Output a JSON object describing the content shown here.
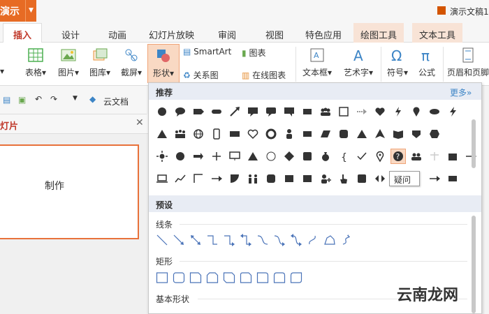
{
  "app": {
    "menu_label": "演示",
    "doc_title": "演示文稿1"
  },
  "tabs": [
    "插入",
    "设计",
    "动画",
    "幻灯片放映",
    "审阅",
    "视图",
    "特色应用",
    "绘图工具",
    "文本工具"
  ],
  "ribbon": {
    "table": "表格",
    "picture": "图片",
    "gallery": "图库",
    "screenshot": "截屏",
    "shapes": "形状",
    "smartart": "SmartArt",
    "chart": "图表",
    "relation": "关系图",
    "online_chart": "在线图表",
    "textbox": "文本框",
    "wordart": "艺术字",
    "symbol": "符号",
    "formula": "公式",
    "header_footer": "页眉和页脚"
  },
  "quickbar": {
    "cloud_docs": "云文档"
  },
  "left_panel": {
    "title": "灯片",
    "slide_text": "制作"
  },
  "dropdown": {
    "recommend_label": "推荐",
    "more_label": "更多»",
    "preset_label": "预设",
    "lines_label": "线条",
    "rect_label": "矩形",
    "basic_label": "基本形状",
    "tooltip": "疑问"
  },
  "watermark": "云南龙网",
  "colors": {
    "accent": "#e76b24",
    "selected_bg": "#f9d9c3",
    "shape_fill": "#333333",
    "line_blue": "#4a73b8",
    "header_bg": "#e8ecf4"
  }
}
